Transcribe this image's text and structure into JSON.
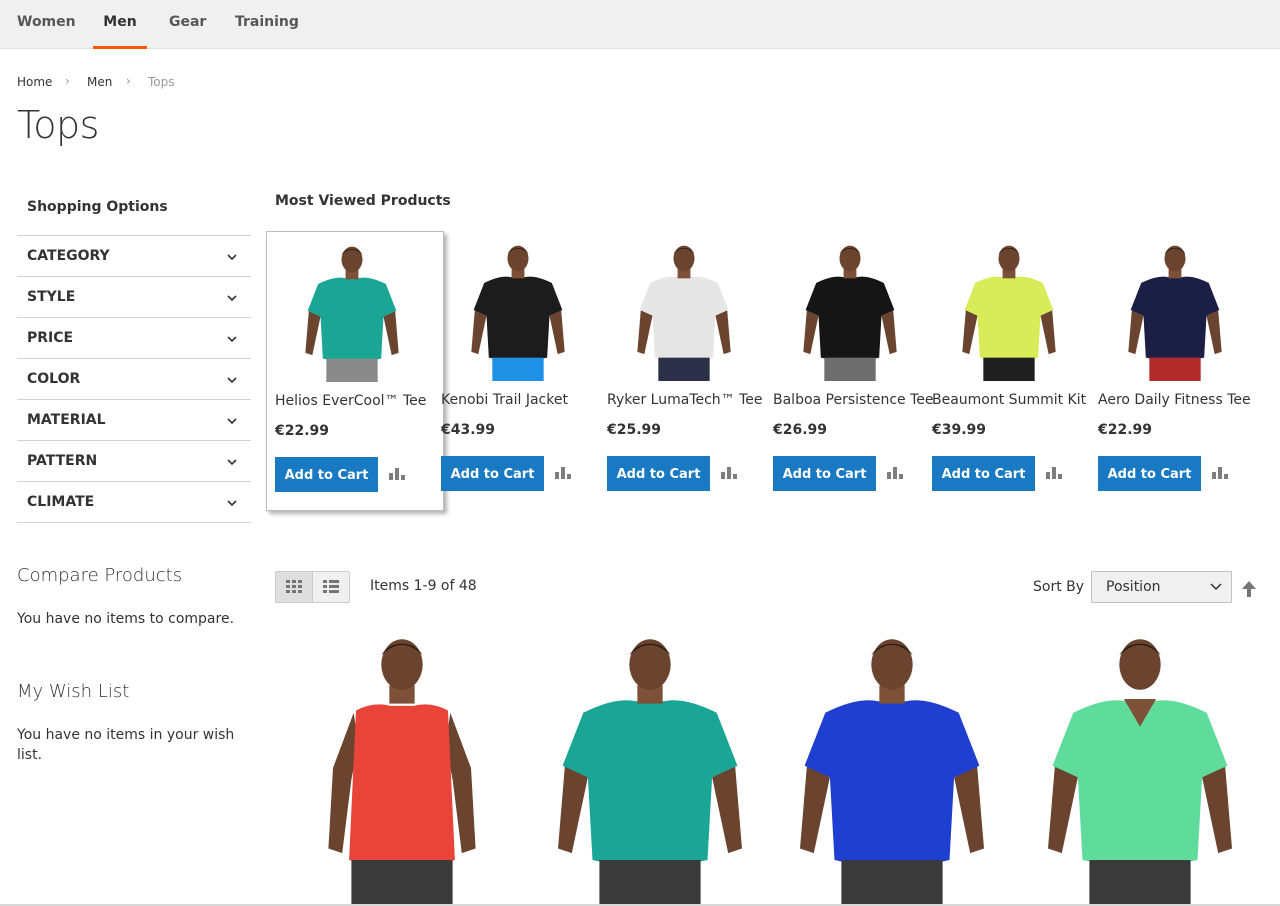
{
  "nav": {
    "items": [
      {
        "label": "Women"
      },
      {
        "label": "Men"
      },
      {
        "label": "Gear"
      },
      {
        "label": "Training"
      }
    ],
    "active": "Men",
    "accent_color": "#ff5501"
  },
  "breadcrumb": [
    "Home",
    "Men",
    "Tops"
  ],
  "page_title": "Tops",
  "sidebar": {
    "shopping_options_title": "Shopping Options",
    "filters": [
      "Category",
      "Style",
      "Price",
      "Color",
      "Material",
      "Pattern",
      "Climate"
    ],
    "compare_title": "Compare Products",
    "compare_empty": "You have no items to compare.",
    "wishlist_title": "My Wish List",
    "wishlist_empty": "You have no items in your wish list."
  },
  "most_viewed": {
    "title": "Most Viewed Products",
    "add_to_cart_label": "Add to Cart",
    "button_color": "#1979c3",
    "products": [
      {
        "name": "Helios EverCool™ Tee",
        "price": "€22.99",
        "shirt_color": "#1aa594",
        "shorts_color": "#8a8a8a"
      },
      {
        "name": "Kenobi Trail Jacket",
        "price": "€43.99",
        "shirt_color": "#1c1c1c",
        "shorts_color": "#1e90e6"
      },
      {
        "name": "Ryker LumaTech™ Tee",
        "price": "€25.99",
        "shirt_color": "#e6e6e6",
        "shorts_color": "#2b3048"
      },
      {
        "name": "Balboa Persistence Tee",
        "price": "€26.99",
        "shirt_color": "#151515",
        "shorts_color": "#6e6e6e"
      },
      {
        "name": "Beaumont Summit Kit",
        "price": "€39.99",
        "shirt_color": "#d8ec5a",
        "shorts_color": "#1f1f1f"
      },
      {
        "name": "Aero Daily Fitness Tee",
        "price": "€22.99",
        "shirt_color": "#1b1f45",
        "shorts_color": "#b32a2a"
      }
    ]
  },
  "toolbar": {
    "items_text": "Items 1-9 of 48",
    "sort_label": "Sort By",
    "sort_value": "Position"
  },
  "grid_products": [
    {
      "shirt_color": "#e8443a",
      "style": "tank"
    },
    {
      "shirt_color": "#1aa594",
      "style": "tee"
    },
    {
      "shirt_color": "#1f3fd0",
      "style": "tee"
    },
    {
      "shirt_color": "#5fdc9b",
      "style": "vneck"
    }
  ]
}
